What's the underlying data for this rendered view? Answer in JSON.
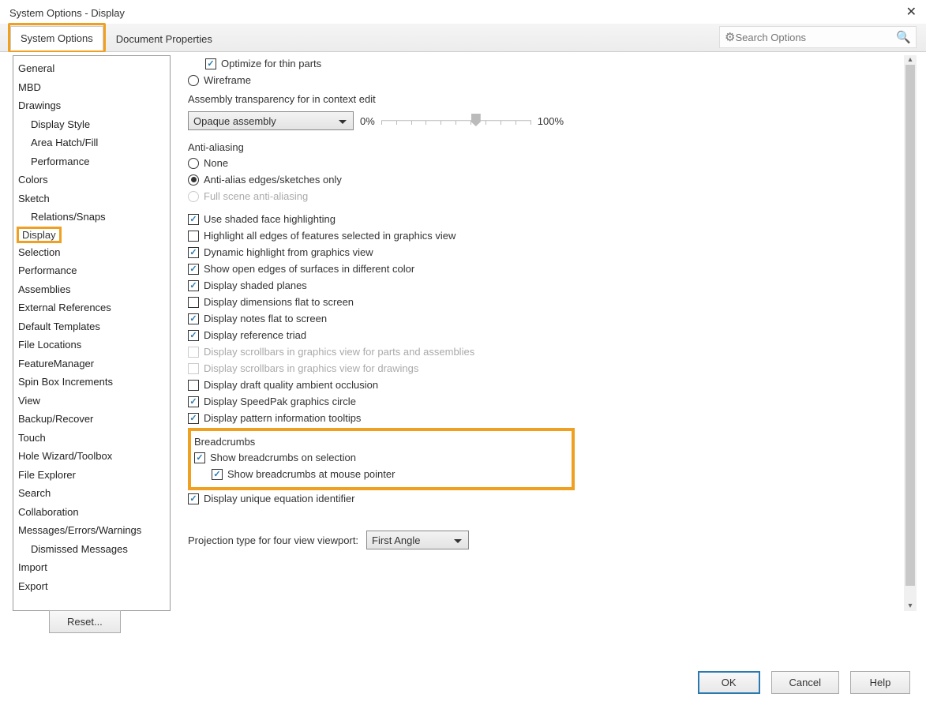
{
  "title": "System Options - Display",
  "tabs": {
    "system_options": "System Options",
    "document_properties": "Document Properties"
  },
  "search": {
    "placeholder": "Search Options"
  },
  "sidebar": {
    "items": [
      {
        "label": "General"
      },
      {
        "label": "MBD"
      },
      {
        "label": "Drawings"
      },
      {
        "label": "Display Style",
        "sub": true
      },
      {
        "label": "Area Hatch/Fill",
        "sub": true
      },
      {
        "label": "Performance",
        "sub": true
      },
      {
        "label": "Colors"
      },
      {
        "label": "Sketch"
      },
      {
        "label": "Relations/Snaps",
        "sub": true
      },
      {
        "label": "Display",
        "selected": true
      },
      {
        "label": "Selection"
      },
      {
        "label": "Performance"
      },
      {
        "label": "Assemblies"
      },
      {
        "label": "External References"
      },
      {
        "label": "Default Templates"
      },
      {
        "label": "File Locations"
      },
      {
        "label": "FeatureManager"
      },
      {
        "label": "Spin Box Increments"
      },
      {
        "label": "View"
      },
      {
        "label": "Backup/Recover"
      },
      {
        "label": "Touch"
      },
      {
        "label": "Hole Wizard/Toolbox"
      },
      {
        "label": "File Explorer"
      },
      {
        "label": "Search"
      },
      {
        "label": "Collaboration"
      },
      {
        "label": "Messages/Errors/Warnings"
      },
      {
        "label": "Dismissed Messages",
        "sub": true
      },
      {
        "label": "Import"
      },
      {
        "label": "Export"
      }
    ]
  },
  "options": {
    "optimize_thin": "Optimize for thin parts",
    "wireframe": "Wireframe",
    "assembly_transparency_label": "Assembly transparency for in context edit",
    "assembly_transparency_value": "Opaque assembly",
    "slider_min": "0%",
    "slider_max": "100%",
    "anti_aliasing_label": "Anti-aliasing",
    "aa_none": "None",
    "aa_edges": "Anti-alias edges/sketches only",
    "aa_full": "Full scene anti-aliasing",
    "shaded_face": "Use shaded face highlighting",
    "highlight_all_edges": "Highlight all edges of features selected in graphics view",
    "dynamic_highlight": "Dynamic highlight from graphics view",
    "open_edges": "Show open edges of surfaces in different color",
    "shaded_planes": "Display shaded planes",
    "dims_flat": "Display dimensions flat to screen",
    "notes_flat": "Display notes flat to screen",
    "ref_triad": "Display reference triad",
    "scroll_parts": "Display scrollbars in graphics view for parts and assemblies",
    "scroll_drawings": "Display scrollbars in graphics view for drawings",
    "draft_occlusion": "Display draft quality ambient occlusion",
    "speedpak": "Display SpeedPak graphics circle",
    "pattern_tooltips": "Display pattern information tooltips",
    "breadcrumbs_label": "Breadcrumbs",
    "breadcrumbs_on_sel": "Show breadcrumbs on selection",
    "breadcrumbs_mouse": "Show breadcrumbs at mouse pointer",
    "unique_eq": "Display unique equation identifier",
    "projection_label": "Projection type for four view viewport:",
    "projection_value": "First Angle"
  },
  "buttons": {
    "reset": "Reset...",
    "ok": "OK",
    "cancel": "Cancel",
    "help": "Help"
  }
}
